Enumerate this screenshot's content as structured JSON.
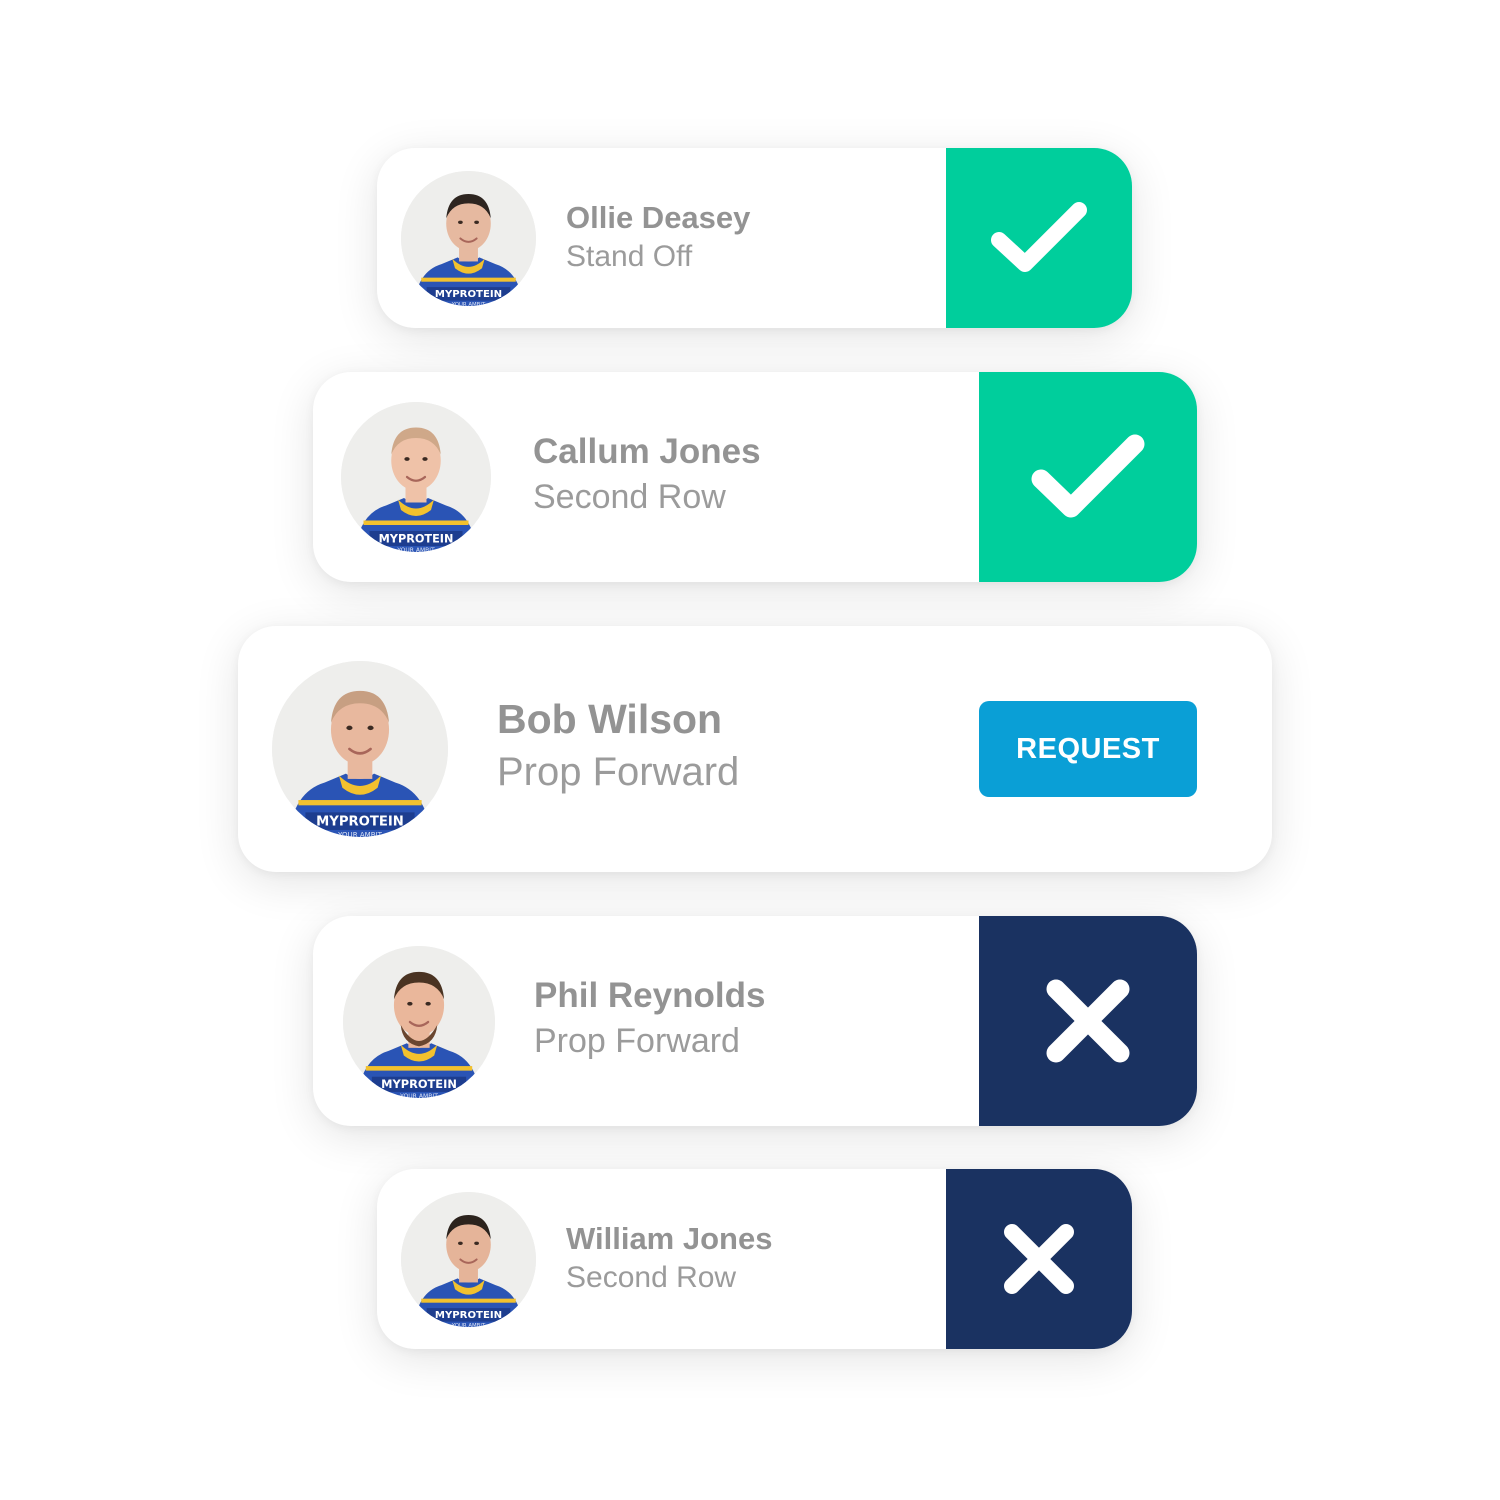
{
  "colors": {
    "approved": "#00ce9c",
    "rejected": "#1a3261",
    "request": "#0a9fd6",
    "name_text": "#939393",
    "role_text": "#9b9b9b"
  },
  "players": [
    {
      "name": "Ollie Deasey",
      "position": "Stand Off",
      "status": "approved",
      "status_icon": "check-icon"
    },
    {
      "name": "Callum Jones",
      "position": "Second Row",
      "status": "approved",
      "status_icon": "check-icon"
    },
    {
      "name": "Bob Wilson",
      "position": "Prop Forward",
      "status": "pending",
      "action_label": "REQUEST"
    },
    {
      "name": "Phil Reynolds",
      "position": "Prop Forward",
      "status": "rejected",
      "status_icon": "cross-icon"
    },
    {
      "name": "William Jones",
      "position": "Second Row",
      "status": "rejected",
      "status_icon": "cross-icon"
    }
  ],
  "avatar_decor": {
    "shirt_text": "MYPROTEIN",
    "motto_text": "YOUR AMBIT"
  }
}
